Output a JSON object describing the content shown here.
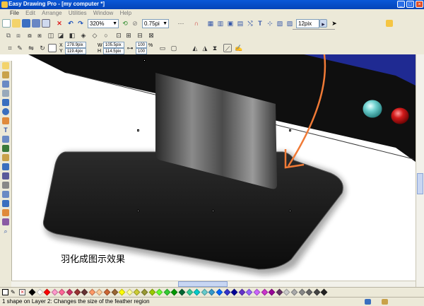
{
  "window": {
    "title": "Easy Drawing Pro - [my computer *]",
    "buttons": [
      "_",
      "□",
      "×"
    ]
  },
  "menu": [
    "File",
    "Edit",
    "Arrange",
    "Utilities",
    "Window",
    "Help"
  ],
  "toolbar": {
    "zoom_value": "320%",
    "line_width_value": "0.75pi",
    "feather_value": "12pix"
  },
  "properties": {
    "x_label": "X",
    "y_label": "Y",
    "x_value": "278.9pix",
    "y_value": "119.4pix",
    "w_label": "W",
    "h_label": "H",
    "w_value": "105.5pix",
    "h_value": "114.5pix",
    "scale_x": "100",
    "scale_y": "100",
    "pct": "%"
  },
  "canvas": {
    "caption": "羽化成图示效果"
  },
  "palette": {
    "colors": [
      "#000000",
      "#ffffff",
      "#ff0000",
      "#ff99cc",
      "#ff6699",
      "#cc3366",
      "#993333",
      "#663333",
      "#ff9966",
      "#ffcc99",
      "#cc6633",
      "#996633",
      "#ffff00",
      "#ffff99",
      "#cccc33",
      "#999933",
      "#99cc00",
      "#66ff33",
      "#33cc33",
      "#009900",
      "#006633",
      "#33cc99",
      "#00cccc",
      "#66cccc",
      "#3399cc",
      "#0066ff",
      "#3333cc",
      "#000099",
      "#6633cc",
      "#9966ff",
      "#cc66ff",
      "#cc33cc",
      "#990099",
      "#663366",
      "#cccccc",
      "#aaaaaa",
      "#888888",
      "#666666",
      "#444444",
      "#222222"
    ]
  },
  "status": {
    "text": "1 shape on Layer 2: Changes the size of the feather region"
  }
}
